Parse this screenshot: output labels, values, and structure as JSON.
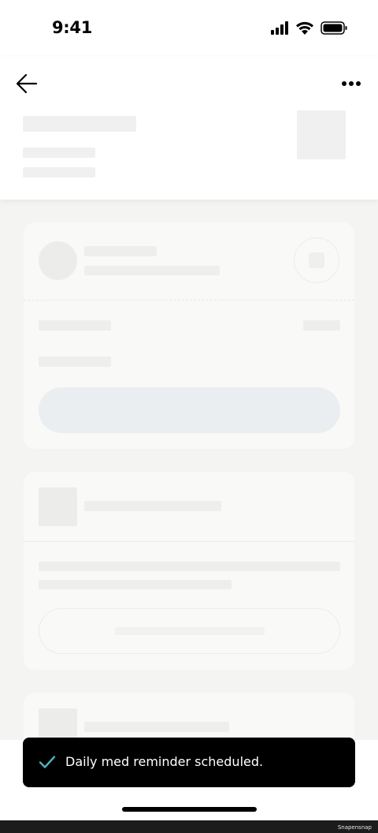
{
  "status_bar": {
    "time": "9:41",
    "icons": [
      "cellular-signal-icon",
      "wifi-icon",
      "battery-icon"
    ]
  },
  "header": {
    "back_icon": "arrow-left-icon",
    "more_icon": "more-horizontal-icon"
  },
  "toast": {
    "icon": "check-icon",
    "icon_color": "#4fb3bf",
    "message": "Daily med reminder scheduled."
  },
  "footer": {
    "watermark": "Snapensnap"
  }
}
